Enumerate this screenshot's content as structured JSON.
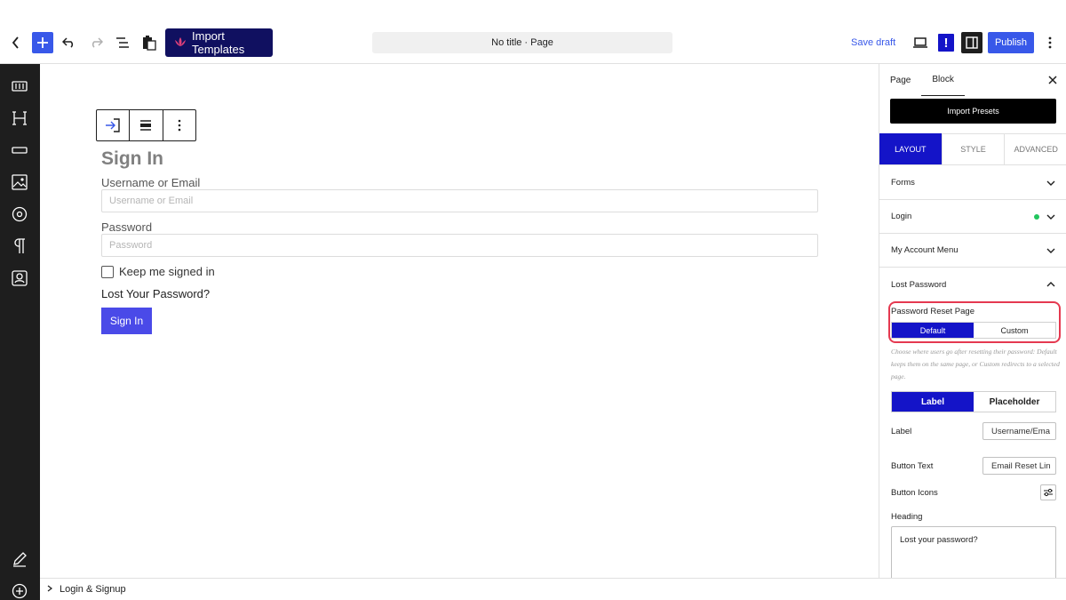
{
  "topbar": {
    "import_templates_label": "Import Templates",
    "doc_title": "No title · Page",
    "save_draft_label": "Save draft",
    "publish_label": "Publish",
    "exclamation_label": "!"
  },
  "canvas": {
    "heading": "Sign In",
    "username_label": "Username or Email",
    "username_placeholder": "Username or Email",
    "password_label": "Password",
    "password_placeholder": "Password",
    "remember_label": "Keep me signed in",
    "lost_password_link": "Lost Your Password?",
    "submit_label": "Sign In"
  },
  "footer": {
    "breadcrumb": "Login & Signup"
  },
  "panel": {
    "tabs": [
      {
        "label": "Page"
      },
      {
        "label": "Block"
      }
    ],
    "import_presets_label": "Import Presets",
    "mode_tabs": [
      {
        "label": "LAYOUT"
      },
      {
        "label": "STYLE"
      },
      {
        "label": "ADVANCED"
      }
    ],
    "sections": [
      {
        "label": "Forms"
      },
      {
        "label": "Login"
      },
      {
        "label": "My Account Menu"
      },
      {
        "label": "Lost Password"
      }
    ],
    "password_reset": {
      "label": "Password Reset Page",
      "options": [
        "Default",
        "Custom"
      ],
      "selected": "Default",
      "help": "Choose where users go after resetting their password: Default keeps them on the same page, or Custom redirects to a selected page."
    },
    "text_mode": {
      "options": [
        "Label",
        "Placeholder"
      ],
      "selected": "Label"
    },
    "label_field": {
      "label": "Label",
      "value": "Username/Ema"
    },
    "button_text_field": {
      "label": "Button Text",
      "value": "Email Reset Lin"
    },
    "button_icons_label": "Button Icons",
    "heading_field": {
      "label": "Heading",
      "value": "Lost your password?"
    }
  },
  "colors": {
    "accent": "#3858e9",
    "active_tab": "#1414c8",
    "highlight": "#e53950",
    "status_dot": "#22c55e"
  }
}
